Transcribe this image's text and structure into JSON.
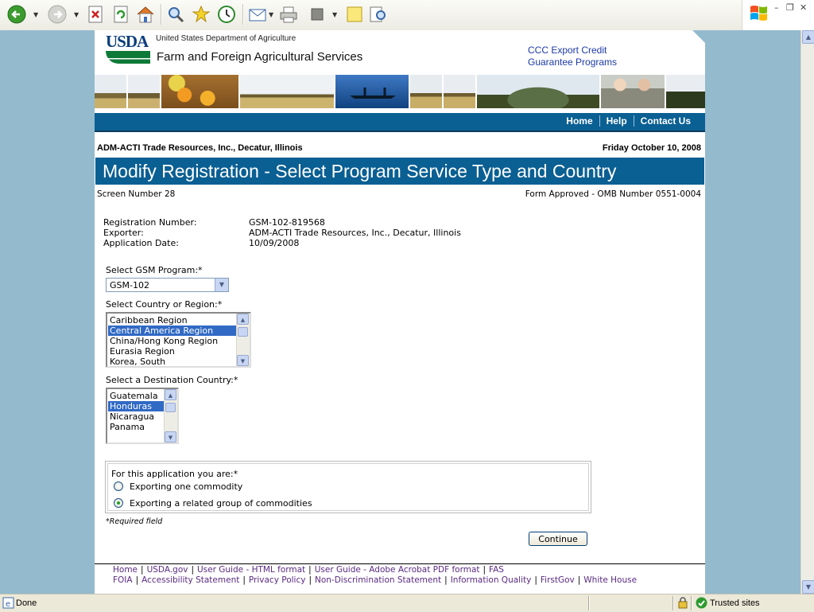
{
  "browser": {
    "toolbar_icons": [
      "back-icon",
      "forward-icon",
      "stop-icon",
      "refresh-icon",
      "home-icon",
      "search-icon",
      "favorites-icon",
      "history-icon",
      "mail-icon",
      "print-icon",
      "edit-icon",
      "discuss-icon",
      "research-icon"
    ],
    "status_text": "Done",
    "zone_text": "Trusted sites"
  },
  "header": {
    "logo_text": "USDA",
    "department": "United States Department of Agriculture",
    "agency": "Farm and Foreign Agricultural Services",
    "program_line1": "CCC Export Credit",
    "program_line2": "Guarantee Programs"
  },
  "nav": {
    "items": [
      "Home",
      "Help",
      "Contact Us"
    ]
  },
  "context": {
    "organization": "ADM-ACTI Trade Resources, Inc., Decatur, Illinois",
    "date": "Friday October 10, 2008"
  },
  "page_title": "Modify Registration - Select Program Service Type and Country",
  "screen_number": "Screen Number 28",
  "omb": "Form Approved - OMB Number 0551-0004",
  "info": [
    {
      "label": "Registration Number:",
      "value": "GSM-102-819568"
    },
    {
      "label": "Exporter:",
      "value": "ADM-ACTI Trade Resources, Inc., Decatur, Illinois"
    },
    {
      "label": "Application Date:",
      "value": "10/09/2008"
    }
  ],
  "form": {
    "gsm_label": "Select GSM Program:*",
    "gsm_value": "GSM-102",
    "region_label": "Select Country or Region:*",
    "regions": [
      "Caribbean Region",
      "Central America Region",
      "China/Hong Kong Region",
      "Eurasia Region",
      "Korea, South"
    ],
    "region_selected": "Central America Region",
    "dest_label": "Select a Destination Country:*",
    "countries": [
      "Guatemala",
      "Honduras",
      "Nicaragua",
      "Panama"
    ],
    "country_selected": "Honduras",
    "app_question": "For this application you are:*",
    "radio_options": [
      "Exporting one commodity",
      "Exporting a related group of commodities"
    ],
    "radio_selected": "Exporting a related group of commodities",
    "required_note": "*Required field",
    "continue_label": "Continue"
  },
  "footer": {
    "links": [
      "Home",
      "USDA.gov",
      "User Guide - HTML format",
      "User Guide - Adobe Acrobat PDF format",
      "FAS",
      "FOIA",
      "Accessibility Statement",
      "Privacy Policy",
      "Non-Discrimination Statement",
      "Information Quality",
      "FirstGov",
      "White House"
    ]
  },
  "colors": {
    "nav_bar": "#0a5f93",
    "viewport_bg": "#94bacd",
    "selection": "#316ac5"
  }
}
